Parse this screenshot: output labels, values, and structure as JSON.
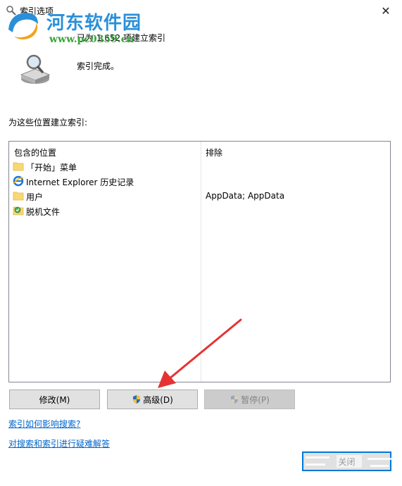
{
  "window": {
    "title": "索引选项",
    "close_glyph": "✕"
  },
  "watermark": {
    "site_name": "河东软件园",
    "site_url": "www.pc0359.cn"
  },
  "status": {
    "indexed_count_text": "已为 1,652 项建立索引",
    "state_text": "索引完成。"
  },
  "locations": {
    "section_label": "为这些位置建立索引:",
    "col_included": "包含的位置",
    "col_excluded": "排除",
    "rows": [
      {
        "name": "「开始」菜单",
        "excluded": "",
        "icon": "folder-icon"
      },
      {
        "name": "Internet Explorer 历史记录",
        "excluded": "",
        "icon": "ie-icon"
      },
      {
        "name": "用户",
        "excluded": "AppData; AppData",
        "icon": "folder-icon"
      },
      {
        "name": "脱机文件",
        "excluded": "",
        "icon": "offline-files-icon"
      }
    ]
  },
  "buttons": {
    "modify": "修改(M)",
    "advanced": "高级(D)",
    "pause": "暂停(P)",
    "close": "关闭"
  },
  "links": {
    "how_affects": "索引如何影响搜索?",
    "troubleshoot": "对搜索和索引进行疑难解答"
  },
  "colors": {
    "link": "#0066cc",
    "focus_border": "#0078d7",
    "annotation_arrow": "#e53333"
  }
}
